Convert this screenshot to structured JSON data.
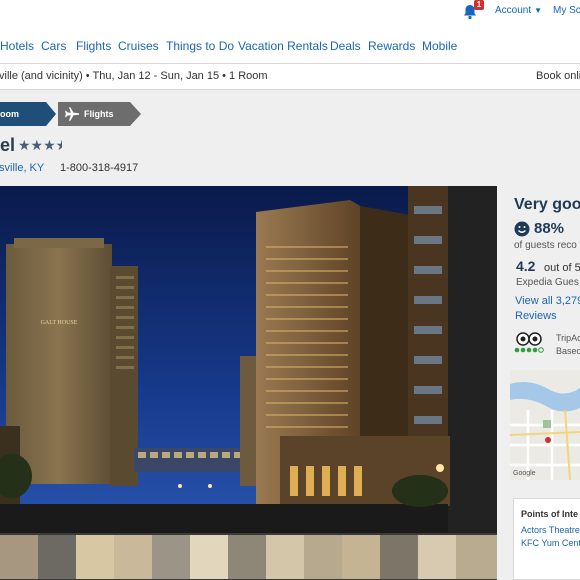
{
  "top_bar": {
    "notification_count": "1",
    "account_label": "Account",
    "my_scratchpad_label": "My Scr"
  },
  "nav": {
    "items": [
      {
        "label": "Hotels"
      },
      {
        "label": "Cars"
      },
      {
        "label": "Flights"
      },
      {
        "label": "Cruises"
      },
      {
        "label": "Things to Do"
      },
      {
        "label": "Vacation Rentals"
      },
      {
        "label": "Deals"
      },
      {
        "label": "Rewards"
      },
      {
        "label": "Mobile"
      }
    ]
  },
  "search_summary": {
    "text": "ville (and vicinity) • Thu, Jan 12 - Sun, Jan 15 • 1 Room",
    "book_online": "Book onli"
  },
  "breadcrumbs": {
    "step1": "oom",
    "step2": "Flights"
  },
  "hotel": {
    "name": "el",
    "stars": "★★★",
    "half_star": "★",
    "location": "sville,  KY",
    "phone": "1-800-318-4917",
    "photo_signage": "GALT HOUSE"
  },
  "reviews": {
    "headline": "Very goo",
    "recommend_percent": "88%",
    "recommend_text": "of guests reco",
    "score": "4.2",
    "out_of": "out of 5",
    "source": "Expedia Gues",
    "view_all": "View all 3,279",
    "reviews_link": "Reviews",
    "tripadvisor": "TripAd",
    "tripadvisor_based": "Based"
  },
  "map": {
    "attribution": "Google"
  },
  "points_of_interest": {
    "title": "Points of Inte",
    "items": [
      "Actors Theatre",
      "KFC Yum Cent"
    ]
  },
  "colors": {
    "brand_blue": "#1a66b8",
    "header_navy": "#1f4e79",
    "crumb_gray": "#6d6d6d",
    "title_navy": "#1e3a57",
    "badge_red": "#d32f2f"
  },
  "icons": [
    "bell-icon",
    "chevron-down-icon",
    "plane-icon",
    "star-icon",
    "chevron-right-icon",
    "smile-icon",
    "tripadvisor-owl-icon"
  ]
}
